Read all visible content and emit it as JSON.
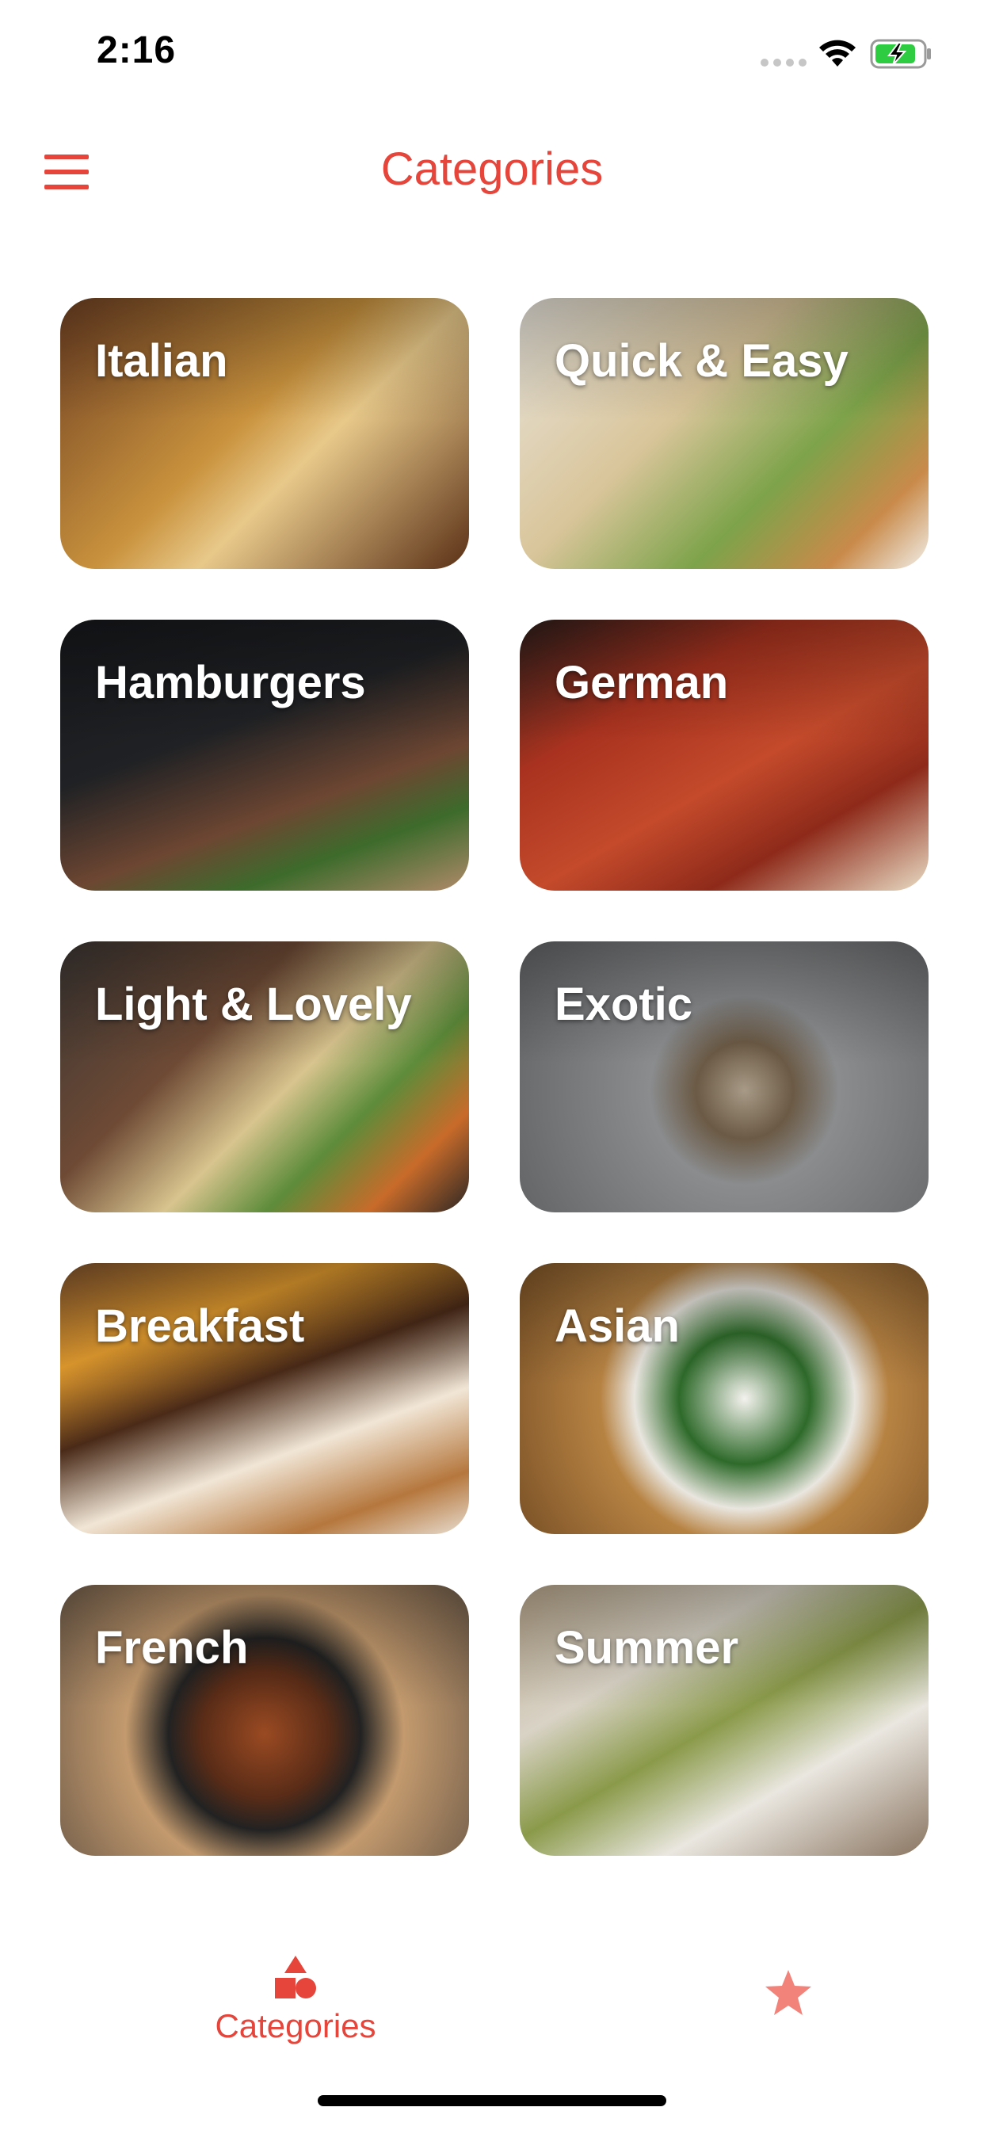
{
  "status_bar": {
    "time": "2:16"
  },
  "header": {
    "title": "Categories",
    "menu_icon": "menu-icon"
  },
  "categories": [
    {
      "name": "Italian",
      "color_top": "#7a4b2a",
      "color_bottom": "#3a2417"
    },
    {
      "name": "Quick & Easy",
      "color_top": "#d9d4cc",
      "color_bottom": "#8a9a5b"
    },
    {
      "name": "Hamburgers",
      "color_top": "#1b1d1f",
      "color_bottom": "#6b4a3a"
    },
    {
      "name": "German",
      "color_top": "#2a1e1c",
      "color_bottom": "#b23a25"
    },
    {
      "name": "Light & Lovely",
      "color_top": "#2e2a28",
      "color_bottom": "#7a4f34"
    },
    {
      "name": "Exotic",
      "color_top": "#8b8d8e",
      "color_bottom": "#4e4f50"
    },
    {
      "name": "Breakfast",
      "color_top": "#8a5b34",
      "color_bottom": "#e7d8c4"
    },
    {
      "name": "Asian",
      "color_top": "#b58042",
      "color_bottom": "#6c4a22"
    },
    {
      "name": "French",
      "color_top": "#5a3a2a",
      "color_bottom": "#c9a17a"
    },
    {
      "name": "Summer",
      "color_top": "#9aa48c",
      "color_bottom": "#e6e2d8"
    }
  ],
  "tabs": [
    {
      "label": "Categories",
      "icon": "shapes-icon",
      "active": true
    },
    {
      "label": "",
      "icon": "star-icon",
      "active": false
    }
  ],
  "colors": {
    "accent": "#e5453a",
    "favorite_star": "#f2837a"
  }
}
